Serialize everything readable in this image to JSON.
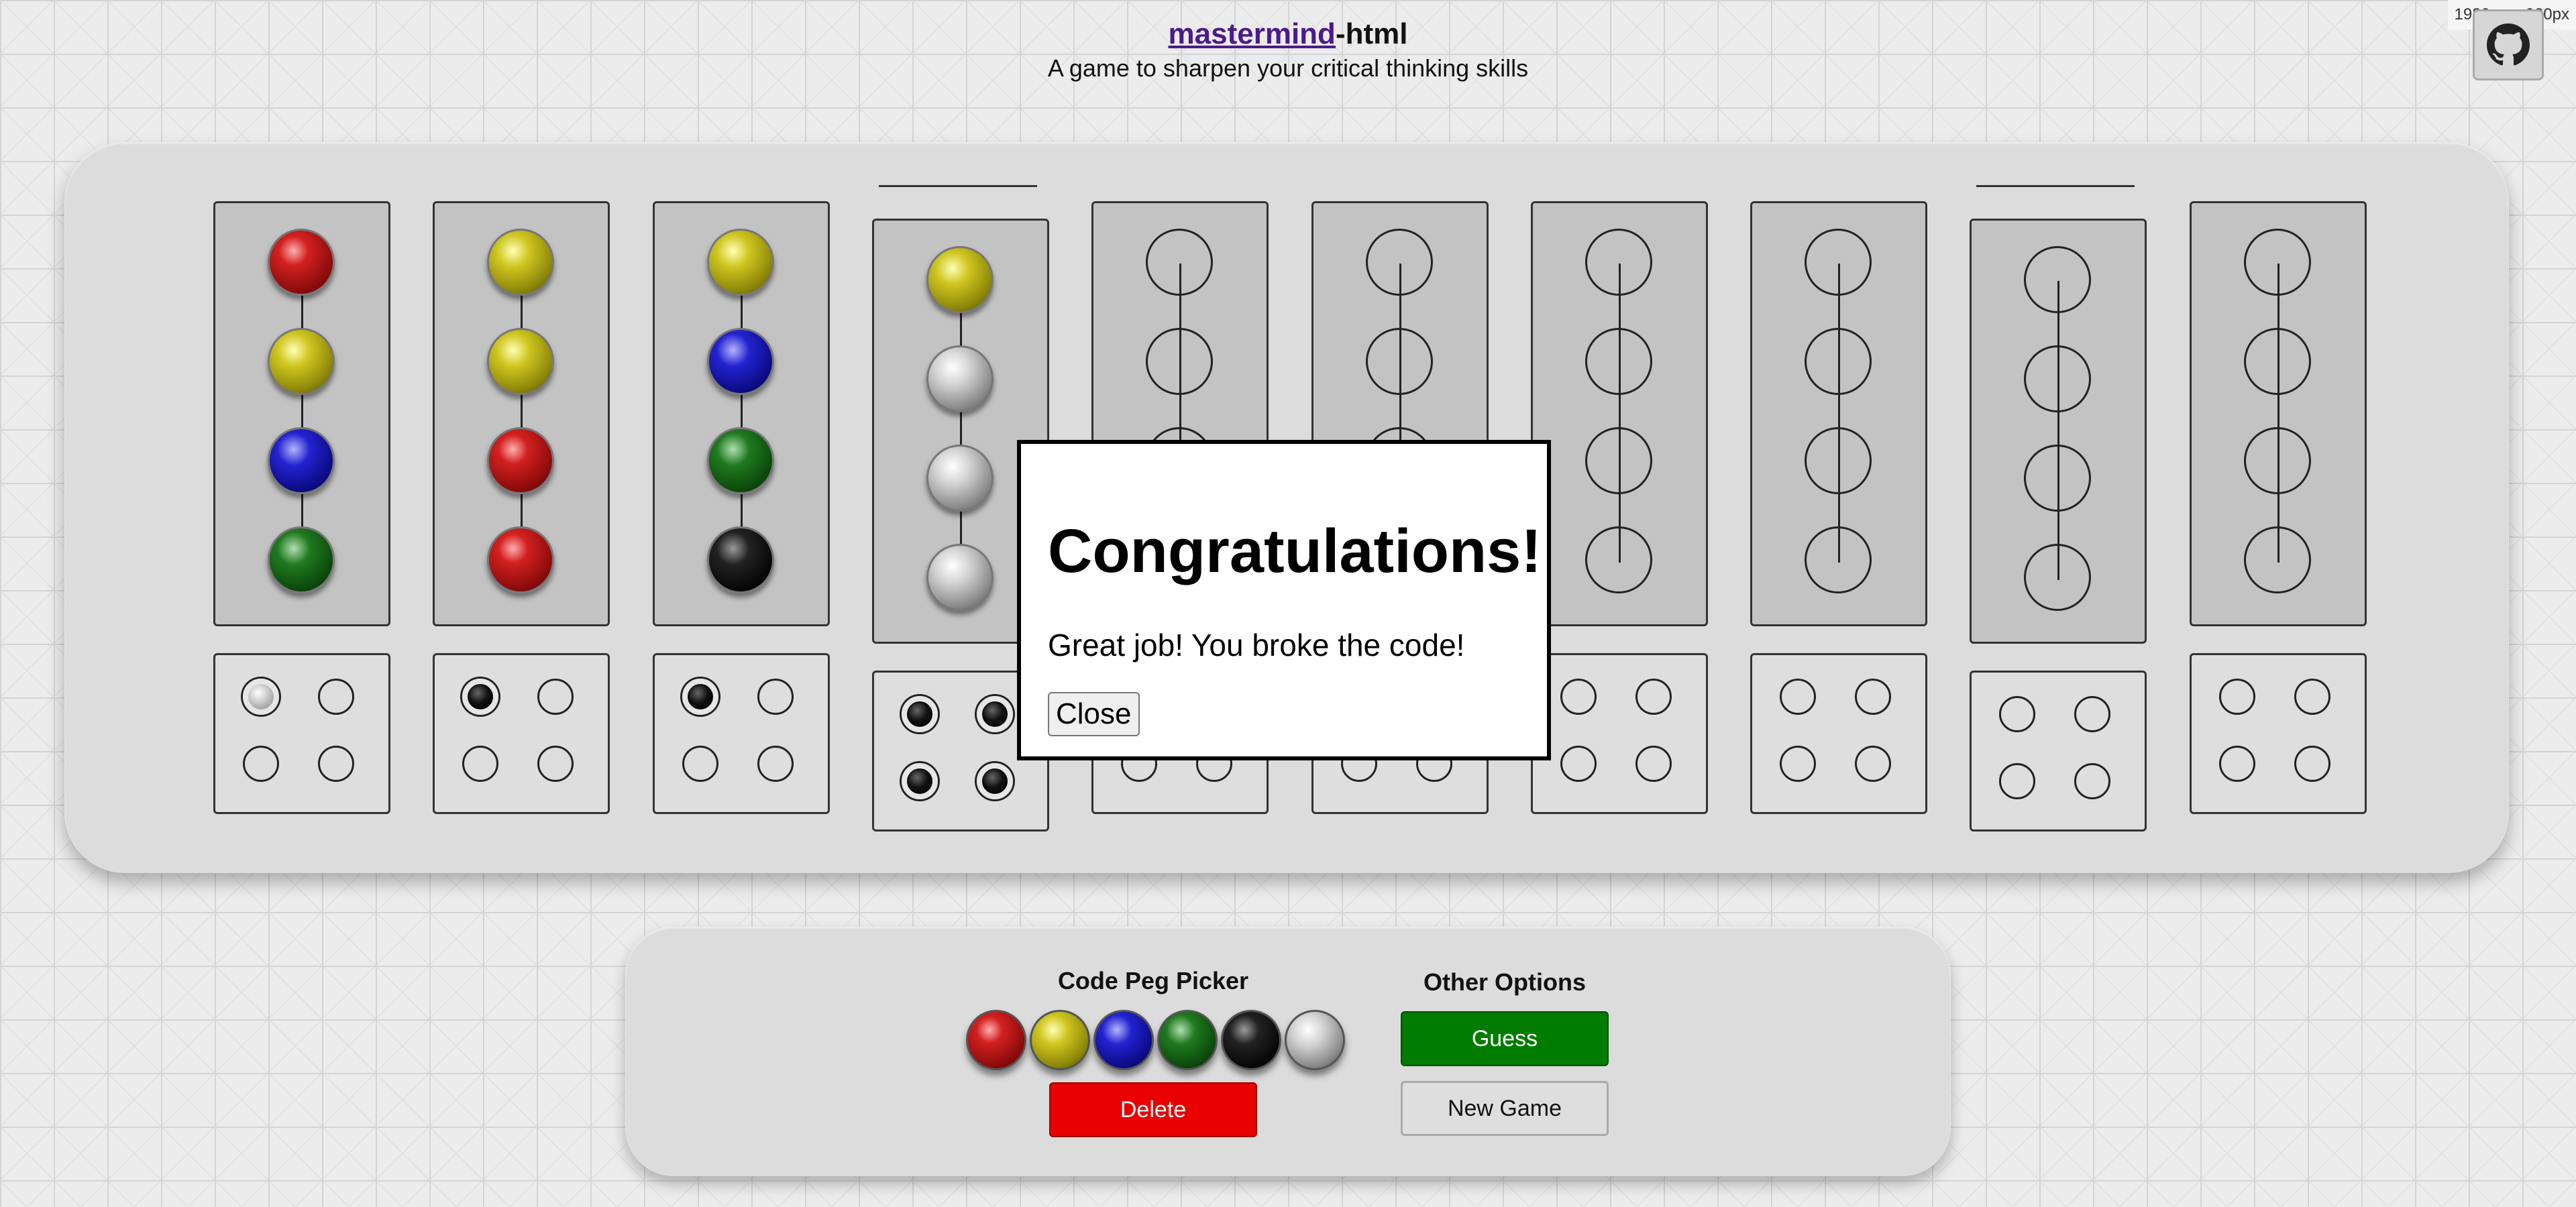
{
  "header": {
    "title_link": "mastermind",
    "title_suffix": "-html",
    "subtitle": "A game to sharpen your critical thinking skills"
  },
  "viewport_badge": "1920px × 900px",
  "github_button": {
    "icon": "github-icon"
  },
  "board": {
    "rows": [
      {
        "pegs": [
          "red",
          "yellow",
          "blue",
          "green"
        ],
        "keys": [
          "white",
          "empty",
          "empty",
          "empty"
        ],
        "raised": false,
        "marked": false
      },
      {
        "pegs": [
          "yellow",
          "yellow",
          "red",
          "red"
        ],
        "keys": [
          "black",
          "empty",
          "empty",
          "empty"
        ],
        "raised": false,
        "marked": false
      },
      {
        "pegs": [
          "yellow",
          "blue",
          "green",
          "black"
        ],
        "keys": [
          "black",
          "empty",
          "empty",
          "empty"
        ],
        "raised": false,
        "marked": false
      },
      {
        "pegs": [
          "yellow",
          "silver",
          "silver",
          "silver"
        ],
        "keys": [
          "black",
          "black",
          "black",
          "black"
        ],
        "raised": true,
        "marked": true
      },
      {
        "pegs": [
          "empty",
          "empty",
          "empty",
          "empty"
        ],
        "keys": [
          "empty",
          "empty",
          "empty",
          "empty"
        ],
        "raised": false,
        "marked": false
      },
      {
        "pegs": [
          "empty",
          "empty",
          "empty",
          "empty"
        ],
        "keys": [
          "empty",
          "empty",
          "empty",
          "empty"
        ],
        "raised": false,
        "marked": false
      },
      {
        "pegs": [
          "empty",
          "empty",
          "empty",
          "empty"
        ],
        "keys": [
          "empty",
          "empty",
          "empty",
          "empty"
        ],
        "raised": false,
        "marked": false
      },
      {
        "pegs": [
          "empty",
          "empty",
          "empty",
          "empty"
        ],
        "keys": [
          "empty",
          "empty",
          "empty",
          "empty"
        ],
        "raised": false,
        "marked": false
      },
      {
        "pegs": [
          "empty",
          "empty",
          "empty",
          "empty"
        ],
        "keys": [
          "empty",
          "empty",
          "empty",
          "empty"
        ],
        "raised": true,
        "marked": true
      },
      {
        "pegs": [
          "empty",
          "empty",
          "empty",
          "empty"
        ],
        "keys": [
          "empty",
          "empty",
          "empty",
          "empty"
        ],
        "raised": false,
        "marked": false
      }
    ]
  },
  "modal": {
    "title": "Congratulations!",
    "message": "Great job! You broke the code!",
    "close_label": "Close"
  },
  "panel": {
    "picker_heading": "Code Peg Picker",
    "picker_colors": [
      "red",
      "yellow",
      "blue",
      "green",
      "black",
      "silver"
    ],
    "delete_label": "Delete",
    "options_heading": "Other Options",
    "guess_label": "Guess",
    "new_game_label": "New Game"
  },
  "colors": {
    "title_link": "#4b1a8c",
    "delete_button": "#e90000",
    "guess_button": "#007c00"
  }
}
